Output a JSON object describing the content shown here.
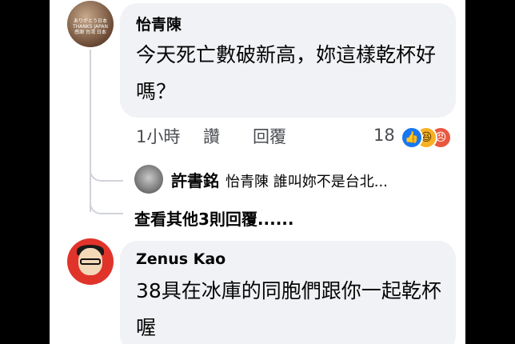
{
  "comment1": {
    "author": "怡青陳",
    "text": "今天死亡數破新高，妳這樣乾杯好嗎？",
    "avatar_text": "ありがとう日本 THANKS JAPAN 感謝 台湾 日本"
  },
  "actions": {
    "time": "1小時",
    "like_label": "讚",
    "reply_label": "回覆",
    "reaction_count": "18",
    "reactions": [
      "like-icon",
      "haha-icon",
      "angry-icon"
    ]
  },
  "reply": {
    "author": "許書銘",
    "text": "怡青陳  誰叫妳不是台北..."
  },
  "more_replies": "查看其他3則回覆......",
  "comment2": {
    "author": "Zenus Kao",
    "text": "38具在冰庫的同胞們跟你一起乾杯喔"
  },
  "colors": {
    "bubble": "#f0f2f5",
    "like": "#1877f2",
    "haha": "#f7b125",
    "angry": "#e9573f"
  }
}
